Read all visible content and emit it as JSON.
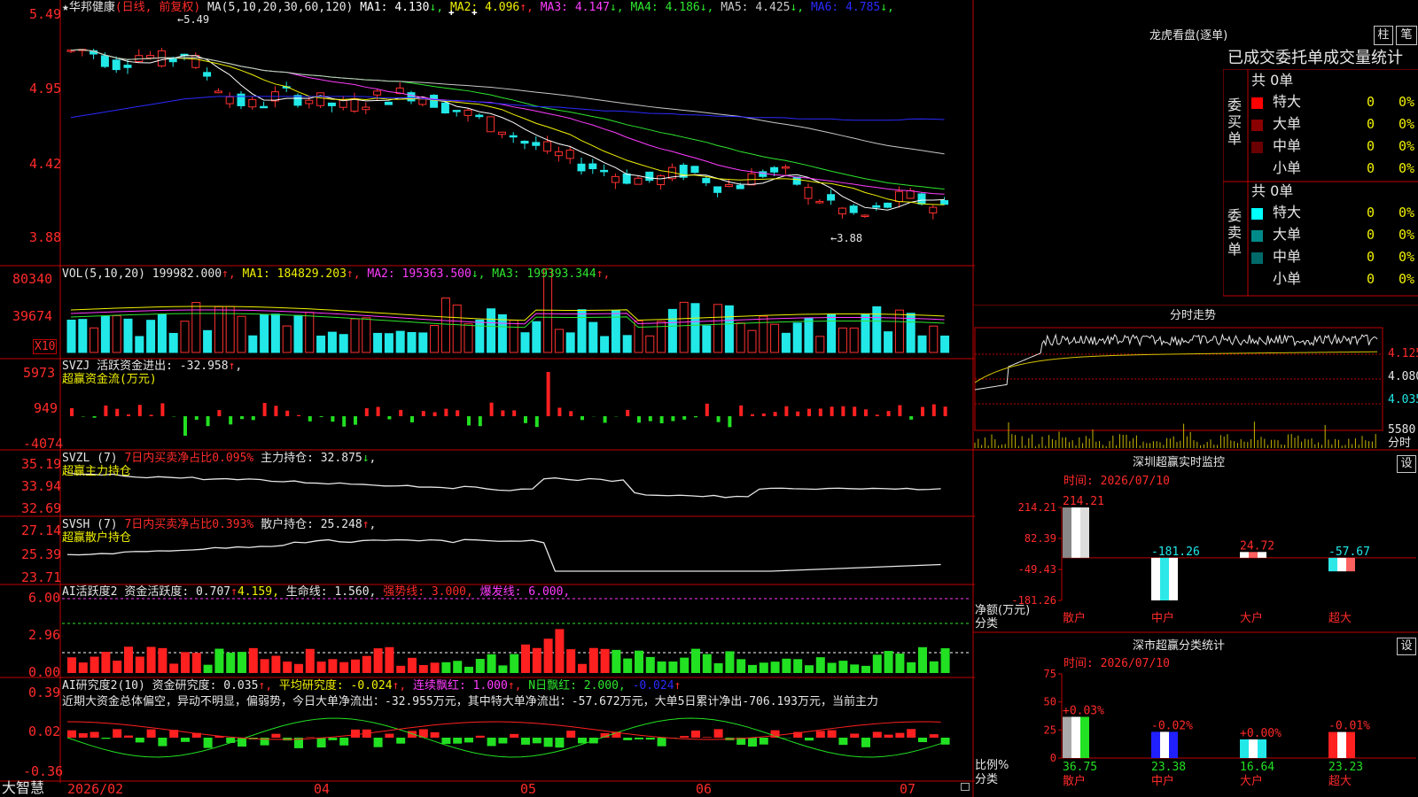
{
  "stock": {
    "name": "华邦健康",
    "mode": "(日线, 前复权)"
  },
  "price_panel": {
    "ma_header": "MA(5,10,20,30,60,120)",
    "ma_items": [
      {
        "label": "MA1: 4.130",
        "arrow": "↓",
        "color": "#ffffff"
      },
      {
        "label": "MA2: 4.096",
        "arrow": "↑",
        "color": "#f0f000"
      },
      {
        "label": "MA3: 4.147",
        "arrow": "↓",
        "color": "#ff3cff"
      },
      {
        "label": "MA4: 4.186",
        "arrow": "↓",
        "color": "#2ee62e"
      },
      {
        "label": "MA5: 4.425",
        "arrow": "↓",
        "color": "#c8c8c8"
      },
      {
        "label": "MA6: 4.785",
        "arrow": "↓",
        "color": "#2a2aff"
      }
    ],
    "y_ticks": [
      "5.49",
      "4.95",
      "4.42",
      "3.88"
    ],
    "high_label": "5.49",
    "low_label": "3.88"
  },
  "vol_panel": {
    "header": "VOL(5,10,20)",
    "vol": "199982.000",
    "ma_items": [
      {
        "label": "MA1: 184829.203",
        "arrow": "↑",
        "color": "#f0f000"
      },
      {
        "label": "MA2: 195363.500",
        "arrow": "↓",
        "color": "#ff3cff"
      },
      {
        "label": "MA3: 199393.344",
        "arrow": "↑",
        "color": "#2ee62e"
      }
    ],
    "y_ticks": [
      "80340",
      "39674"
    ],
    "unit": "X10"
  },
  "svzj_panel": {
    "header": "SVZJ  活跃资金进出: -32.958",
    "arrow": "↑",
    "sub": "超赢资金流(万元)",
    "y_ticks": [
      "5973",
      "949",
      "-4074"
    ]
  },
  "svzl_panel": {
    "header": "SVZL (7)",
    "pct": "7日内买卖净占比0.095%",
    "hold": "主力持仓: 32.875",
    "arrow": "↓",
    "sub": "超赢主力持仓",
    "y_ticks": [
      "35.19",
      "33.94",
      "32.69"
    ]
  },
  "svsh_panel": {
    "header": "SVSH (7)",
    "pct": "7日内买卖净占比0.393%",
    "hold": "散户持仓: 25.248",
    "arrow": "↑",
    "sub": "超赢散户持仓",
    "y_ticks": [
      "27.14",
      "25.39",
      "23.71"
    ]
  },
  "ai_active": {
    "header": "AI活跃度2",
    "l1": "资金活跃度: 0.707",
    "l2": "4.159,",
    "l3": "生命线: 1.560,",
    "l4": "强势线: 3.000,",
    "l5": "爆发线: 6.000,",
    "y_ticks": [
      "6.00",
      "2.96",
      "0.00"
    ]
  },
  "ai_research": {
    "header": "AI研究度2(10)",
    "l1": "资金研究度: 0.035",
    "l2": "平均研究度: -0.024",
    "l3": "连续飘红: 1.000",
    "l4": "N日飘红: 2.000,",
    "l5": "-0.024",
    "y_ticks": [
      "0.39",
      "0.02",
      "-0.36"
    ],
    "note": "近期大资金总体偏空，异动不明显，偏弱势，今日大单净流出：-32.955万元，其中特大单净流出：-57.672万元，大单5日累计净出-706.193万元，当前主力"
  },
  "xaxis": {
    "brand": "大智慧",
    "labels": [
      "2026/02",
      "04",
      "05",
      "06",
      "07"
    ]
  },
  "right": {
    "lhb_title": "龙虎看盘(逐单)",
    "btn_bar": "柱",
    "btn_bi": "笔",
    "stats_title": "已成交委托单成交量统计",
    "buy": {
      "side_label": [
        "委",
        "买",
        "单"
      ],
      "total": "共 0单",
      "rows": [
        {
          "name": "特大",
          "count": "0",
          "pct": "0%",
          "color": "#ff0000"
        },
        {
          "name": "大单",
          "count": "0",
          "pct": "0%",
          "color": "#8a0000"
        },
        {
          "name": "中单",
          "count": "0",
          "pct": "0%",
          "color": "#6a0000"
        },
        {
          "name": "小单",
          "count": "0",
          "pct": "0%",
          "color": "#000000"
        }
      ]
    },
    "sell": {
      "side_label": [
        "委",
        "卖",
        "单"
      ],
      "total": "共 0单",
      "rows": [
        {
          "name": "特大",
          "count": "0",
          "pct": "0%",
          "color": "#00ffff"
        },
        {
          "name": "大单",
          "count": "0",
          "pct": "0%",
          "color": "#008a8a"
        },
        {
          "name": "中单",
          "count": "0",
          "pct": "0%",
          "color": "#006a6a"
        },
        {
          "name": "小单",
          "count": "0",
          "pct": "0%",
          "color": "#000000"
        }
      ]
    },
    "intraday": {
      "title": "分时走势",
      "prices": [
        "4.125",
        "4.080",
        "4.035"
      ],
      "vol_label": "5580",
      "unit": "分时"
    },
    "monitor": {
      "title": "深圳超赢实时监控",
      "btn": "设",
      "time": "时间: 2026/07/10",
      "y_ticks": [
        "214.21",
        "82.39",
        "-49.43",
        "-181.26"
      ],
      "bars": [
        {
          "name": "散户",
          "value": "214.21"
        },
        {
          "name": "中户",
          "value": "-181.26"
        },
        {
          "name": "大户",
          "value": "24.72"
        },
        {
          "name": "超大",
          "value": "-57.67"
        }
      ],
      "ylabel": "净额(万元)",
      "xlabel": "分类"
    },
    "classify": {
      "title": "深市超赢分类统计",
      "btn": "设",
      "time": "时间: 2026/07/10",
      "y_ticks": [
        "75",
        "50",
        "25",
        "0"
      ],
      "bars": [
        {
          "name": "散户",
          "value": "36.75",
          "delta": "+0.03%"
        },
        {
          "name": "中户",
          "value": "23.38",
          "delta": "-0.02%"
        },
        {
          "name": "大户",
          "value": "16.64",
          "delta": "+0.00%"
        },
        {
          "name": "超大",
          "value": "23.23",
          "delta": "-0.01%"
        }
      ],
      "ylabel": "比例%",
      "xlabel": "分类"
    }
  },
  "chart_data": [
    {
      "type": "line",
      "title": "",
      "series": [
        {
          "name": "MA1",
          "values": [
            5.3,
            5.32,
            5.25,
            5.2,
            5.28,
            5.26,
            5.22,
            5.3,
            5.18,
            5.05,
            4.95,
            4.88,
            4.92,
            4.98,
            4.96,
            4.94,
            4.9,
            4.88,
            4.92,
            4.95,
            4.97,
            4.99,
            4.95,
            4.9,
            4.85,
            4.8,
            4.75,
            4.7,
            4.62,
            4.58,
            4.52,
            4.48,
            4.44,
            4.4,
            4.36,
            4.34,
            4.32,
            4.36,
            4.4,
            4.36,
            4.3,
            4.28,
            4.34,
            4.4,
            4.38,
            4.3,
            4.2,
            4.16,
            4.08,
            4.05,
            4.1,
            4.18,
            4.2,
            4.15,
            4.13
          ]
        },
        {
          "name": "MA6",
          "values": [
            4.8,
            4.82,
            4.84,
            4.86,
            4.88,
            4.9,
            4.92,
            4.94,
            4.95,
            4.96,
            4.96,
            4.96,
            4.96,
            4.96,
            4.96,
            4.96,
            4.96,
            4.96,
            4.96,
            4.95,
            4.95,
            4.95,
            4.94,
            4.93,
            4.93,
            4.92,
            4.91,
            4.9,
            4.89,
            4.88,
            4.88,
            4.87,
            4.86,
            4.85,
            4.85,
            4.84,
            4.83,
            4.83,
            4.82,
            4.82,
            4.81,
            4.81,
            4.8,
            4.8,
            4.8,
            4.79,
            4.79,
            4.79,
            4.78,
            4.78,
            4.78,
            4.78,
            4.79,
            4.79,
            4.785
          ]
        }
      ]
    },
    {
      "type": "bar",
      "title": "深圳超赢实时监控",
      "categories": [
        "散户",
        "中户",
        "大户",
        "超大"
      ],
      "values": [
        214.21,
        -181.26,
        24.72,
        -57.67
      ],
      "ylabel": "净额(万元)",
      "xlabel": "分类",
      "ylim": [
        -181.26,
        214.21
      ]
    },
    {
      "type": "bar",
      "title": "深市超赢分类统计",
      "categories": [
        "散户",
        "中户",
        "大户",
        "超大"
      ],
      "values": [
        36.75,
        23.38,
        16.64,
        23.23
      ],
      "ylabel": "比例%",
      "xlabel": "分类",
      "ylim": [
        0,
        75
      ]
    }
  ]
}
